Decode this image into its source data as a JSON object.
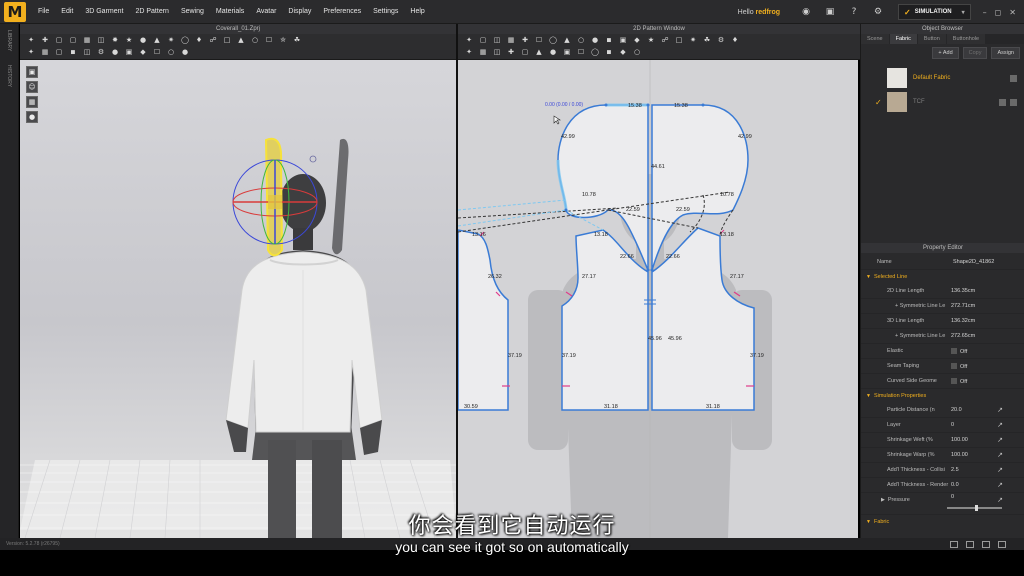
{
  "menubar": {
    "logo": "M",
    "items": [
      "File",
      "Edit",
      "3D Garment",
      "2D Pattern",
      "Sewing",
      "Materials",
      "Avatar",
      "Display",
      "Preferences",
      "Settings",
      "Help"
    ],
    "user_prefix": "Hello",
    "user_name": "redfrog",
    "simulation_label": "SIMULATION"
  },
  "left_strip": {
    "labels": [
      "LIBRARY",
      "HISTORY"
    ]
  },
  "window_3d": {
    "title": "Coverall_01.Zprj"
  },
  "window_2d": {
    "title": "2D Pattern Window",
    "coord_label": "0.00 (0.00 / 0.00)",
    "measurements": [
      "15.38",
      "15.38",
      "42.99",
      "42.99",
      "44.61",
      "10.78",
      "10.78",
      "22.59",
      "22.59",
      "13.16",
      "13.18",
      "13.18",
      "22.66",
      "22.66",
      "26.32",
      "27.17",
      "27.17",
      "45.96",
      "45.96",
      "37.19",
      "37.19",
      "37.19",
      "30.59",
      "31.18",
      "31.18"
    ]
  },
  "object_browser": {
    "title": "Object Browser",
    "tabs": [
      "Scene",
      "Fabric",
      "Button",
      "Buttonhole"
    ],
    "active_tab": "Fabric",
    "actions": [
      "+ Add",
      "Copy",
      "Assign"
    ],
    "fabrics": [
      {
        "name": "Default Fabric",
        "color": "#e6e4e0"
      },
      {
        "name": "TCF",
        "color": "#b8a993"
      }
    ]
  },
  "property_editor": {
    "title": "Property Editor",
    "name_label": "Name",
    "name_value": "Shape2D_41862",
    "sections": {
      "selected_line": "Selected Line",
      "simulation": "Simulation Properties",
      "fabric": "Fabric"
    },
    "selected_line_rows": [
      {
        "label": "2D Line Length",
        "value": "136.35cm",
        "indent": false
      },
      {
        "label": "+ Symmetric Line Le",
        "value": "272.71cm",
        "indent": true
      },
      {
        "label": "3D Line Length",
        "value": "136.32cm",
        "indent": false
      },
      {
        "label": "+ Symmetric Line Le",
        "value": "272.65cm",
        "indent": true
      },
      {
        "label": "Elastic",
        "value": "Off",
        "indent": false
      },
      {
        "label": "Seam Taping",
        "value": "Off",
        "indent": false
      },
      {
        "label": "Curved Side Geome",
        "value": "Off",
        "indent": false
      }
    ],
    "simulation_rows": [
      {
        "label": "Particle Distance (n",
        "value": "20.0"
      },
      {
        "label": "Layer",
        "value": "0"
      },
      {
        "label": "Shrinkage Weft (%",
        "value": "100.00"
      },
      {
        "label": "Shrinkage Warp (%",
        "value": "100.00"
      },
      {
        "label": "Add'l Thickness - Collisi",
        "value": "2.5"
      },
      {
        "label": "Add'l Thickness - Render",
        "value": "0.0"
      }
    ],
    "pressure_label": "Pressure",
    "pressure_value": "0"
  },
  "status": {
    "text": "Version: 5.2.78 (r26795)"
  },
  "subtitles": {
    "chinese": "你会看到它自动运行",
    "english": "you can see it got so on automatically"
  },
  "colors": {
    "accent": "#f2b01e",
    "pattern_outline": "#3a7bd5",
    "selection_blue": "#7fc8f0"
  }
}
